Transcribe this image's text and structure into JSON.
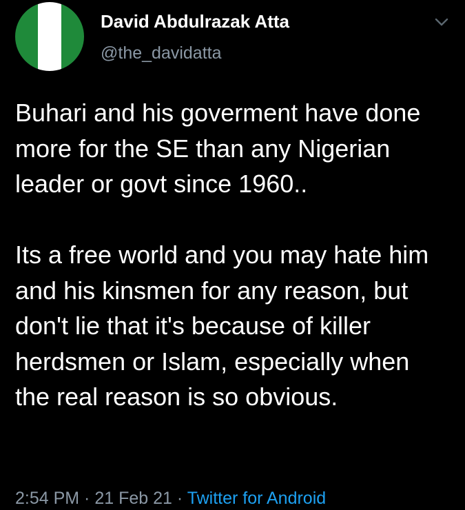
{
  "tweet": {
    "author": {
      "display_name": "David Abdulrazak Atta",
      "handle": "@the_davidatta",
      "avatar_icon": "nigeria-flag-icon",
      "avatar_colors": [
        "#1f8a3a",
        "#ffffff",
        "#1f8a3a"
      ]
    },
    "menu_icon": "chevron-down-icon",
    "body": {
      "paragraph_1": "Buhari and his goverment have done more for the SE than any Nigerian leader or govt since 1960..",
      "paragraph_2": "Its a free world and you may hate him and his kinsmen for any reason, but don't lie that it's because of killer herdsmen or Islam, especially when the real reason is so obvious."
    },
    "meta": {
      "time": "2:54 PM",
      "separator": " · ",
      "date": "21 Feb 21",
      "source": "Twitter for Android"
    }
  },
  "colors": {
    "background": "#000000",
    "text_primary": "#ffffff",
    "text_secondary": "#8b98a5",
    "link": "#1da1f2"
  }
}
